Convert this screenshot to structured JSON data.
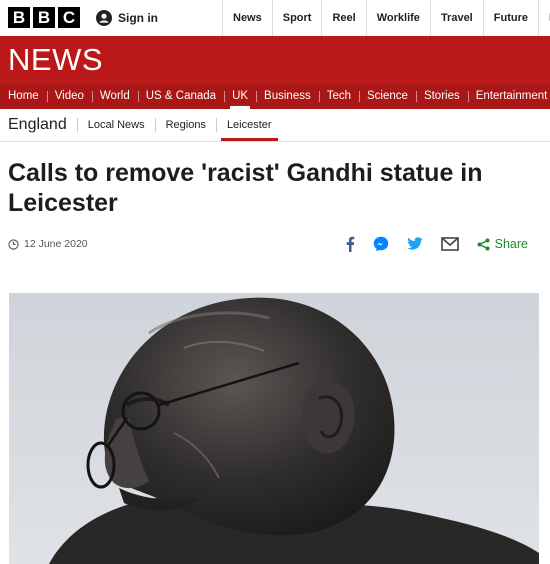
{
  "brand": {
    "logo_letters": [
      "B",
      "B",
      "C"
    ],
    "wordmark": "NEWS",
    "color": "#bb1919"
  },
  "header": {
    "signin_label": "Sign in",
    "nav": [
      "News",
      "Sport",
      "Reel",
      "Worklife",
      "Travel",
      "Future",
      "Mo"
    ]
  },
  "sections": [
    "Home",
    "Video",
    "World",
    "US & Canada",
    "UK",
    "Business",
    "Tech",
    "Science",
    "Stories",
    "Entertainment"
  ],
  "active_section": "UK",
  "subnav": {
    "region": "England",
    "links": [
      "Local News",
      "Regions",
      "Leicester"
    ],
    "current": "Leicester"
  },
  "article": {
    "headline": "Calls to remove 'racist' Gandhi statue in Leicester",
    "date": "12 June 2020",
    "share_label": "Share",
    "share_color": "#1a8a33",
    "icons": [
      "facebook-icon",
      "messenger-icon",
      "twitter-icon",
      "email-icon",
      "share-icon",
      "clock-icon"
    ]
  }
}
